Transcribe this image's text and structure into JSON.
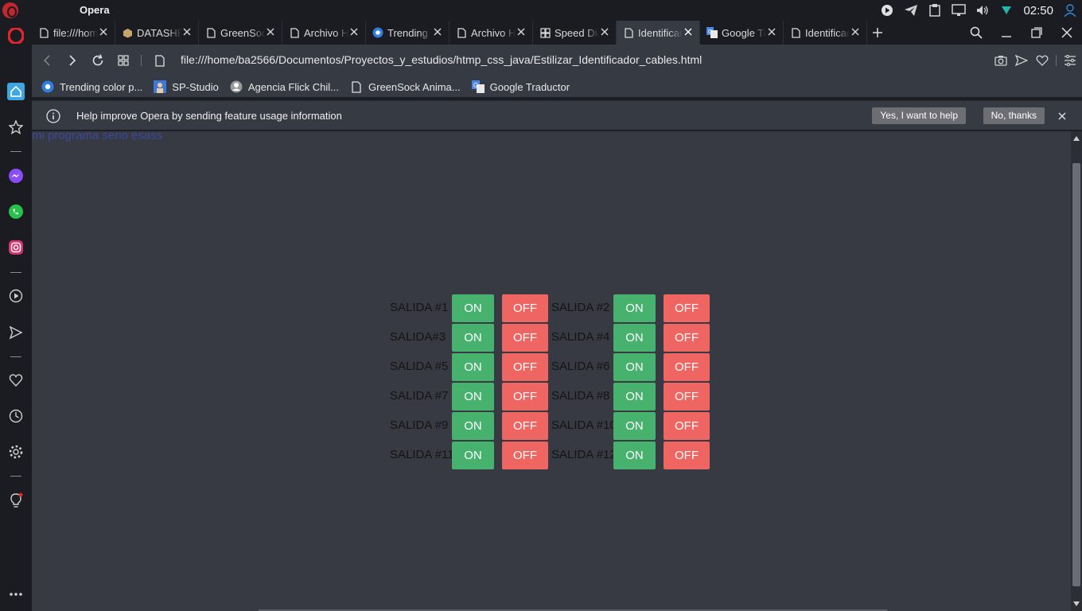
{
  "os": {
    "title": "Opera",
    "clock": "02:50",
    "tray_icons": [
      "media-play-icon",
      "telegram-icon",
      "clipboard-icon",
      "display-icon",
      "volume-icon",
      "network-icon",
      "user-icon"
    ]
  },
  "tabs": [
    {
      "label": "file:///home",
      "favicon": "page-icon",
      "active": false
    },
    {
      "label": "DATASHEET",
      "favicon": "box-icon",
      "active": false
    },
    {
      "label": "GreenSock",
      "favicon": "page-icon",
      "active": false
    },
    {
      "label": "Archivo HTML",
      "favicon": "page-icon",
      "active": false
    },
    {
      "label": "Trending",
      "favicon": "chrome-icon",
      "active": false
    },
    {
      "label": "Archivo HTML",
      "favicon": "page-icon",
      "active": false
    },
    {
      "label": "Speed Dial",
      "favicon": "grid-icon",
      "active": false
    },
    {
      "label": "Identificador",
      "favicon": "page-icon",
      "active": true
    },
    {
      "label": "Google Traductor",
      "favicon": "translate-icon",
      "active": false
    },
    {
      "label": "Identificador",
      "favicon": "page-icon",
      "active": false
    }
  ],
  "address": {
    "url": "file:///home/ba2566/Documentos/Proyectos_y_estudios/htmp_css_java/Estilizar_Identificador_cables.html"
  },
  "bookmarks": [
    {
      "label": "Trending color p...",
      "icon": "chrome-icon"
    },
    {
      "label": "SP-Studio",
      "icon": "sp-studio-icon"
    },
    {
      "label": "Agencia Flick Chil...",
      "icon": "flick-icon"
    },
    {
      "label": "GreenSock Anima...",
      "icon": "page-icon"
    },
    {
      "label": "Google Traductor",
      "icon": "translate-icon"
    }
  ],
  "infobar": {
    "message": "Help improve Opera by sending feature usage information",
    "yes_label": "Yes, I want to help",
    "no_label": "No, thanks"
  },
  "page": {
    "heading": "mi programa serio esass",
    "on_label": "ON",
    "off_label": "OFF",
    "outputs": [
      "SALIDA #1",
      "SALIDA #2",
      "SALIDA#3",
      "SALIDA #4",
      "SALIDA #5",
      "SALIDA #6",
      "SALIDA #7",
      "SALIDA #8",
      "SALIDA #9",
      "SALIDA #10",
      "SALIDA #11",
      "SALIDA #12"
    ]
  },
  "colors": {
    "on_button": "#47b26e",
    "off_button": "#ef6562",
    "content_bg": "#373a42",
    "opera_red": "#c1272d"
  }
}
